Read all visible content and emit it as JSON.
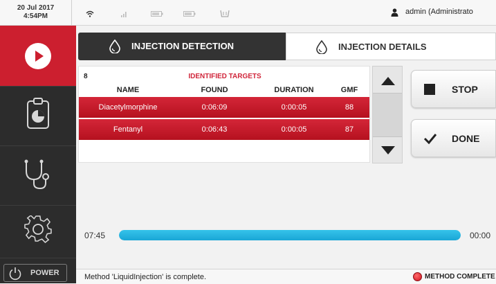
{
  "status_bar": {
    "date": "20 Jul 2017",
    "time": "4:54PM",
    "user": "admin (Administrato"
  },
  "sidebar": {
    "items": [
      {
        "name": "run",
        "icon": "play-icon",
        "active": true
      },
      {
        "name": "report",
        "icon": "clipboard-chart-icon"
      },
      {
        "name": "diagnostics",
        "icon": "stethoscope-icon"
      },
      {
        "name": "settings",
        "icon": "gear-icon"
      }
    ],
    "power_label": "POWER"
  },
  "tabs": [
    {
      "label": "INJECTION DETECTION",
      "icon": "droplet-icon",
      "active": true
    },
    {
      "label": "INJECTION DETAILS",
      "icon": "droplet-icon",
      "active": false
    }
  ],
  "results": {
    "count": "8",
    "title": "IDENTIFIED TARGETS",
    "columns": [
      "NAME",
      "FOUND",
      "DURATION",
      "GMF"
    ],
    "rows": [
      {
        "name": "Diacetylmorphine",
        "found": "0:06:09",
        "duration": "0:00:05",
        "gmf": "88"
      },
      {
        "name": "Fentanyl",
        "found": "0:06:43",
        "duration": "0:00:05",
        "gmf": "87"
      }
    ]
  },
  "actions": {
    "stop_label": "STOP",
    "done_label": "DONE"
  },
  "progress": {
    "elapsed": "07:45",
    "remaining": "00:00",
    "fraction": 1.0
  },
  "footer": {
    "message": "Method 'LiquidInjection' is complete.",
    "state": "METHOD COMPLETE"
  },
  "colors": {
    "accent_red": "#cc1f2f",
    "progress_blue": "#1aa6d6",
    "sidebar_bg": "#2c2c2c"
  }
}
